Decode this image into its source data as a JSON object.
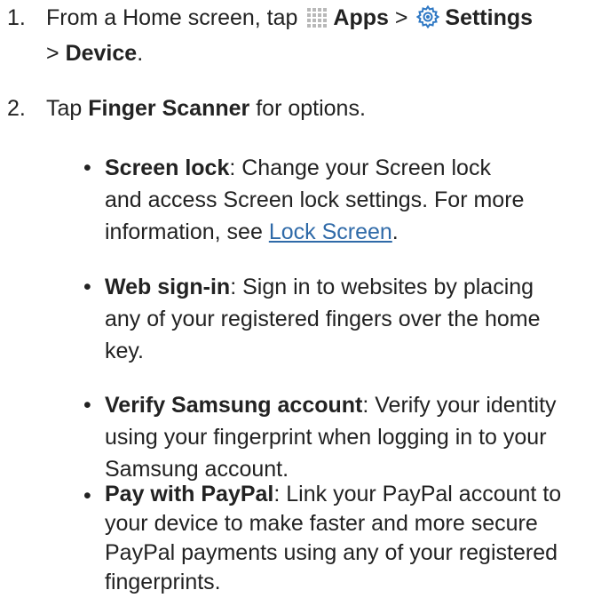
{
  "steps": [
    {
      "number": "1.",
      "text_before_apps": "From a Home screen, tap",
      "apps_label": "Apps",
      "separator1": ">",
      "settings_label": "Settings",
      "separator2": ">",
      "device_label": "Device",
      "end": ".",
      "apps_icon": "apps-grid-icon",
      "settings_icon": "settings-gear-icon"
    },
    {
      "number": "2.",
      "text_before": "Tap",
      "bold": "Finger Scanner",
      "text_after": "for options."
    }
  ],
  "bullets": [
    {
      "title": "Screen lock",
      "line1": ": Change your Screen lock",
      "line2": "and access Screen lock settings. For more",
      "line3_before": "information, see",
      "link": "Lock Screen",
      "line3_after": "."
    },
    {
      "title": "Web sign-in",
      "line1": ": Sign in to websites by placing",
      "line2": "any of your registered fingers over the home",
      "line3": "key."
    },
    {
      "title": "Verify Samsung account",
      "line1": ": Verify your identity",
      "line2": "using your fingerprint when logging in to your",
      "line3": "Samsung account."
    },
    {
      "title": "Pay with PayPal",
      "line1": ": Link your PayPal account to",
      "line2": "your device to make faster and more secure",
      "line3": "PayPal payments using any of your registered",
      "line4": "fingerprints."
    }
  ],
  "colors": {
    "text": "#222222",
    "link": "#2f6aa8",
    "settings_icon": "#2e78c4",
    "apps_icon": "#b8b8b8"
  }
}
